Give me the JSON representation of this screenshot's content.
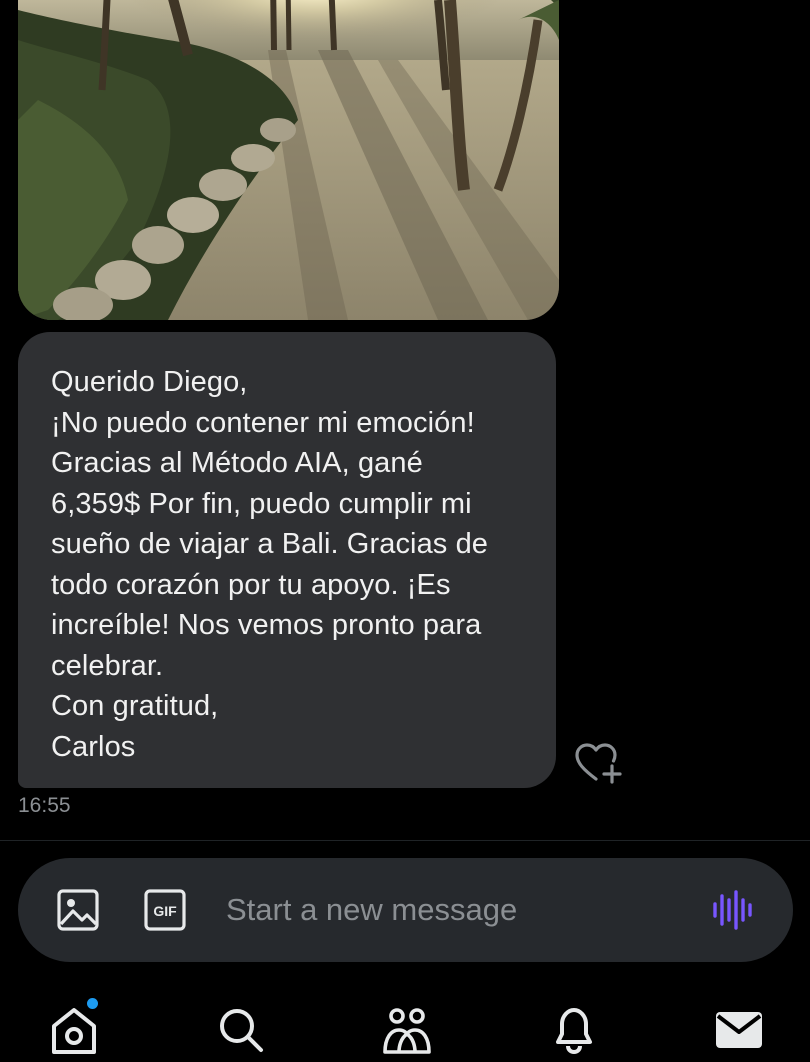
{
  "message": {
    "lines": [
      "Querido Diego,",
      "¡No puedo contener mi emoción!",
      "Gracias al Método AIA, gané",
      "6,359$ Por fin, puedo cumplir mi",
      "sueño de viajar a Bali. Gracias de",
      "todo corazón por tu apoyo. ¡Es",
      "increíble! Nos vemos pronto para",
      "celebrar.",
      "Con gratitud,",
      "Carlos"
    ],
    "time": "16:55"
  },
  "composer": {
    "placeholder": "Start a new message",
    "gif_label": "GIF"
  },
  "nav": {
    "items": [
      "home-icon",
      "search-icon",
      "communities-icon",
      "notifications-icon",
      "messages-icon"
    ],
    "home_has_badge": true
  },
  "colors": {
    "background": "#000000",
    "bubble": "#2f3033",
    "composer": "#26292d",
    "accent": "#1d9bf0",
    "voice": "#7856ff"
  }
}
